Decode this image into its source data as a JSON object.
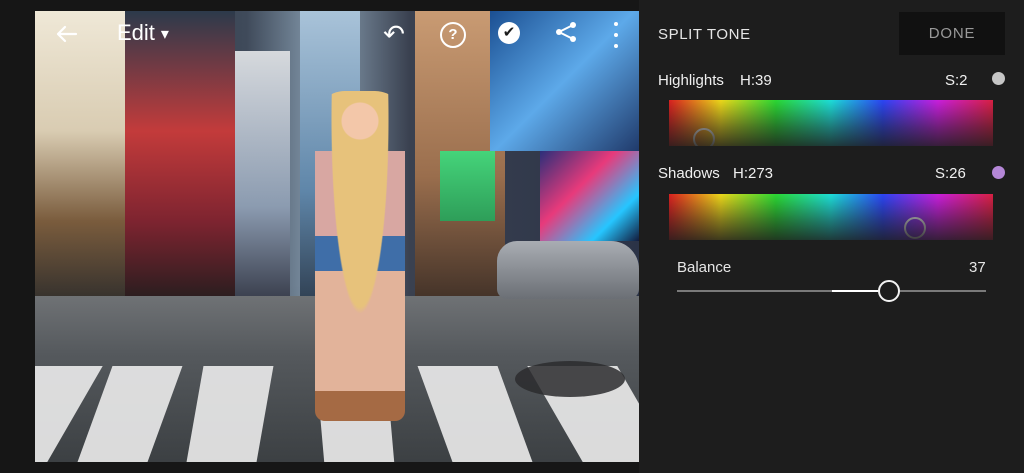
{
  "toolbar": {
    "back_icon": "back-arrow-icon",
    "edit_label": "Edit",
    "edit_caret_icon": "chevron-down-icon",
    "undo_icon": "undo-icon",
    "help_icon_text": "?",
    "confirm_icon_text": "✔",
    "share_icon": "share-icon",
    "more_icon": "more-vertical-icon"
  },
  "panel": {
    "title": "SPLIT TONE",
    "done_label": "DONE",
    "highlights": {
      "label": "Highlights",
      "hue_text": "H:39",
      "sat_text": "S:2",
      "hue": 39,
      "saturation": 2,
      "swatch_color": "#c6c6c6"
    },
    "shadows": {
      "label": "Shadows",
      "hue_text": "H:273",
      "sat_text": "S:26",
      "hue": 273,
      "saturation": 26,
      "swatch_color": "#b487d7"
    },
    "balance": {
      "label": "Balance",
      "value_text": "37",
      "value": 37,
      "min": -100,
      "max": 100
    }
  }
}
